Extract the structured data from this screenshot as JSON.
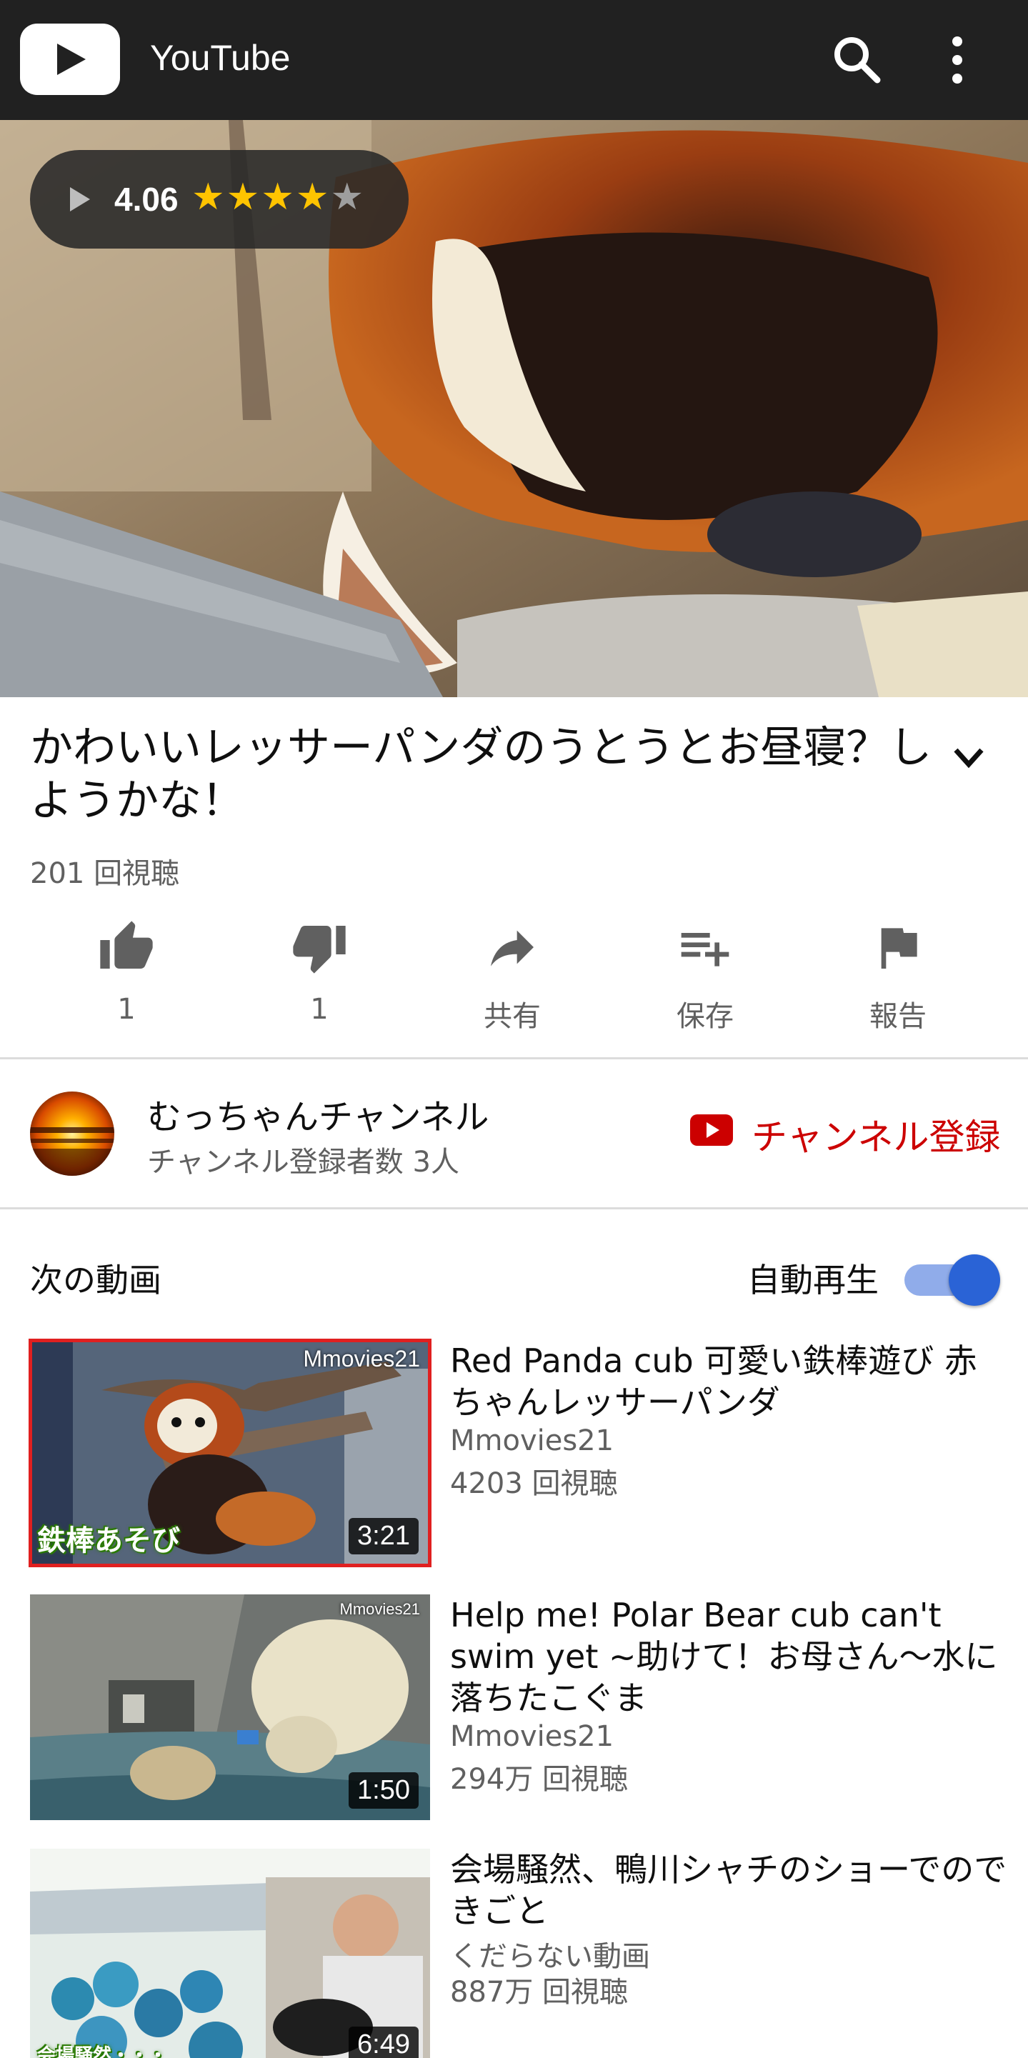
{
  "app": {
    "title": "YouTube"
  },
  "player": {
    "rating": "4.06",
    "stars_filled": 4,
    "stars_total": 5
  },
  "video": {
    "title": "かわいいレッサーパンダのうとうとお昼寝？しようかな！",
    "views": "201 回視聴"
  },
  "actions": [
    {
      "icon": "thumb-up-icon",
      "label": "1"
    },
    {
      "icon": "thumb-down-icon",
      "label": "1"
    },
    {
      "icon": "share-icon",
      "label": "共有"
    },
    {
      "icon": "playlist-add-icon",
      "label": "保存"
    },
    {
      "icon": "flag-icon",
      "label": "報告"
    }
  ],
  "channel": {
    "name": "むっちゃんチャンネル",
    "subscribers": "チャンネル登録者数 3人",
    "subscribe_label": "チャンネル登録"
  },
  "up_next": {
    "label": "次の動画",
    "autoplay_label": "自動再生",
    "autoplay_on": true
  },
  "videos": [
    {
      "title": "Red Panda cub 可愛い鉄棒遊び 赤ちゃんレッサーパンダ",
      "channel": "Mmovies21",
      "views": "4203 回視聴",
      "duration": "3:21",
      "thumb_watermark": "Mmovies21",
      "thumb_caption": "鉄棒あそび",
      "selected": true
    },
    {
      "title": "Help me! Polar Bear cub can't swim yet ~助けて！お母さん～水に落ちたこぐま",
      "channel": "Mmovies21",
      "views": "294万 回視聴",
      "duration": "1:50",
      "thumb_watermark": "Mmovies21"
    },
    {
      "title": "会場騒然、鴨川シャチのショーでのできごと",
      "channel": "くだらない動画",
      "views": "887万 回視聴",
      "duration": "6:49",
      "thumb_caption": "会場騒然・・・"
    }
  ],
  "colors": {
    "topbar": "#212121",
    "subscribe_red": "#cc0000",
    "toggle_blue": "#2a63d6",
    "star": "#ffc400"
  }
}
